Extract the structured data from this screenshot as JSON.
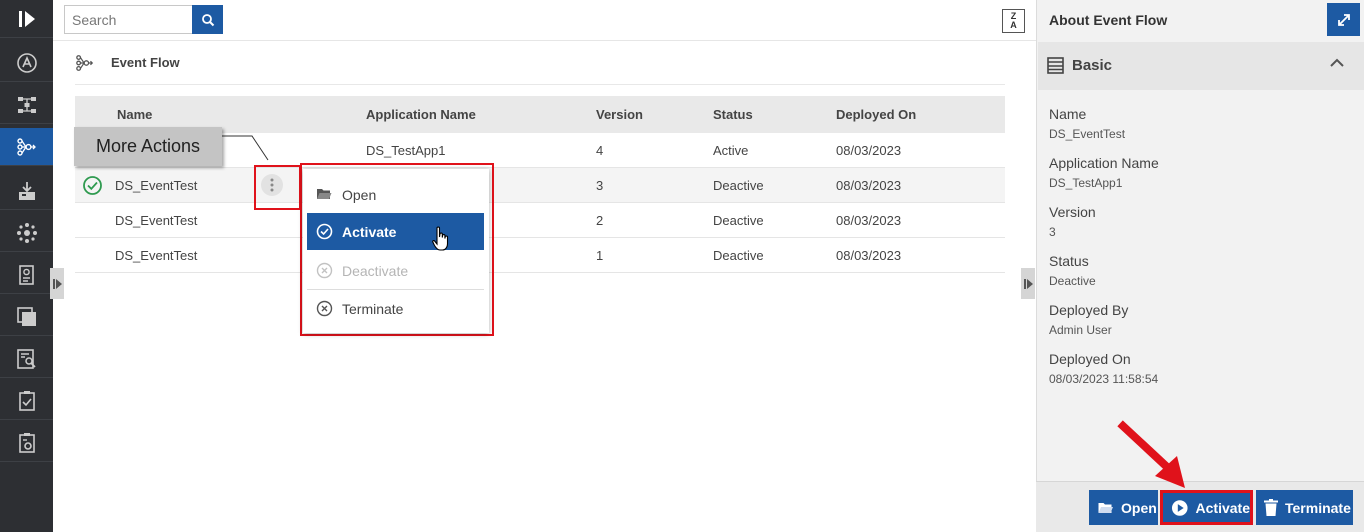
{
  "sidebar": {
    "items": [
      {
        "icon": "play-logo-icon"
      },
      {
        "icon": "a-circle-icon"
      },
      {
        "icon": "network-icon"
      },
      {
        "icon": "event-flow-icon"
      },
      {
        "icon": "deploy-icon"
      },
      {
        "icon": "cluster-icon"
      },
      {
        "icon": "report-icon"
      },
      {
        "icon": "layers-icon"
      },
      {
        "icon": "search-log-icon"
      },
      {
        "icon": "checklist-icon"
      },
      {
        "icon": "settings-doc-icon"
      }
    ],
    "active_index": 3
  },
  "search": {
    "placeholder": "Search"
  },
  "sort_button": {
    "top": "Z",
    "bottom": "A"
  },
  "breadcrumb": {
    "label": "Event Flow"
  },
  "table": {
    "headers": [
      "Name",
      "Application Name",
      "Version",
      "Status",
      "Deployed On"
    ],
    "rows": [
      {
        "name": "",
        "app": "DS_TestApp1",
        "version": "4",
        "status": "Active",
        "deployed": "08/03/2023"
      },
      {
        "name": "DS_EventTest",
        "app": "",
        "version": "3",
        "status": "Deactive",
        "deployed": "08/03/2023"
      },
      {
        "name": "DS_EventTest",
        "app": "",
        "version": "2",
        "status": "Deactive",
        "deployed": "08/03/2023"
      },
      {
        "name": "DS_EventTest",
        "app": "",
        "version": "1",
        "status": "Deactive",
        "deployed": "08/03/2023"
      }
    ]
  },
  "callout": {
    "text": "More Actions"
  },
  "context_menu": {
    "items": [
      {
        "label": "Open",
        "icon": "folder-open-icon"
      },
      {
        "label": "Activate",
        "icon": "check-circle-icon"
      },
      {
        "label": "Deactivate",
        "icon": "x-circle-icon"
      },
      {
        "label": "Terminate",
        "icon": "x-circle-icon"
      }
    ]
  },
  "panel": {
    "title": "About Event Flow",
    "section": "Basic",
    "fields": [
      {
        "label": "Name",
        "value": "DS_EventTest"
      },
      {
        "label": "Application Name",
        "value": "DS_TestApp1"
      },
      {
        "label": "Version",
        "value": "3"
      },
      {
        "label": "Status",
        "value": "Deactive"
      },
      {
        "label": "Deployed By",
        "value": "Admin User"
      },
      {
        "label": "Deployed On",
        "value": "08/03/2023 11:58:54"
      }
    ],
    "buttons": {
      "open": "Open",
      "activate": "Activate",
      "terminate": "Terminate"
    }
  },
  "colors": {
    "accent": "#1d5aa3",
    "highlight": "#e0121b",
    "rail": "#2d2f33",
    "success": "#2e9a4f"
  }
}
